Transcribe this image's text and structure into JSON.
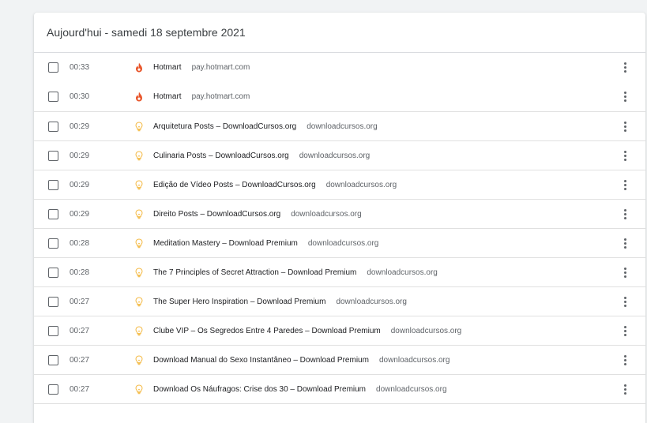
{
  "header": {
    "title": "Aujourd'hui - samedi 18 septembre 2021"
  },
  "colors": {
    "hotmart_flame": "#e8552a",
    "bulb": "#f4b942"
  },
  "entries": [
    {
      "time": "00:33",
      "icon": "hotmart-flame-icon",
      "title": "Hotmart",
      "domain": "pay.hotmart.com"
    },
    {
      "time": "00:30",
      "icon": "hotmart-flame-icon",
      "title": "Hotmart",
      "domain": "pay.hotmart.com"
    },
    {
      "time": "00:29",
      "icon": "lightbulb-icon",
      "title": "Arquitetura Posts – DownloadCursos.org",
      "domain": "downloadcursos.org"
    },
    {
      "time": "00:29",
      "icon": "lightbulb-icon",
      "title": "Culinaria Posts – DownloadCursos.org",
      "domain": "downloadcursos.org"
    },
    {
      "time": "00:29",
      "icon": "lightbulb-icon",
      "title": "Edição de Vídeo Posts – DownloadCursos.org",
      "domain": "downloadcursos.org"
    },
    {
      "time": "00:29",
      "icon": "lightbulb-icon",
      "title": "Direito Posts – DownloadCursos.org",
      "domain": "downloadcursos.org"
    },
    {
      "time": "00:28",
      "icon": "lightbulb-icon",
      "title": "Meditation Mastery – Download Premium",
      "domain": "downloadcursos.org"
    },
    {
      "time": "00:28",
      "icon": "lightbulb-icon",
      "title": "The 7 Principles of Secret Attraction – Download Premium",
      "domain": "downloadcursos.org"
    },
    {
      "time": "00:27",
      "icon": "lightbulb-icon",
      "title": "The Super Hero Inspiration – Download Premium",
      "domain": "downloadcursos.org"
    },
    {
      "time": "00:27",
      "icon": "lightbulb-icon",
      "title": "Clube VIP – Os Segredos Entre 4 Paredes – Download Premium",
      "domain": "downloadcursos.org"
    },
    {
      "time": "00:27",
      "icon": "lightbulb-icon",
      "title": "Download Manual do Sexo Instantâneo – Download Premium",
      "domain": "downloadcursos.org"
    },
    {
      "time": "00:27",
      "icon": "lightbulb-icon",
      "title": "Download Os Náufragos: Crise dos 30 – Download Premium",
      "domain": "downloadcursos.org"
    }
  ]
}
